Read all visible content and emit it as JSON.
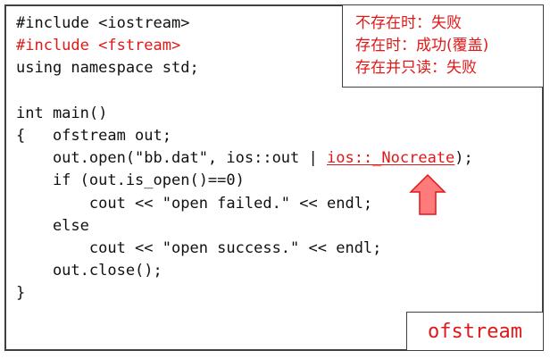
{
  "code": {
    "lines": [
      [
        {
          "text": "#include <iostream>",
          "color": "#111111"
        }
      ],
      [
        {
          "text": "#include <fstream>",
          "color": "#e01818"
        }
      ],
      [
        {
          "text": "using namespace std;",
          "color": "#111111"
        }
      ],
      [
        {
          "text": "",
          "color": "#111111"
        }
      ],
      [
        {
          "text": "int main()",
          "color": "#111111"
        }
      ],
      [
        {
          "text": "{   ofstream out;",
          "color": "#111111"
        }
      ],
      [
        {
          "text": "    out.open(\"bb.dat\", ios::out | ",
          "color": "#111111"
        },
        {
          "text": "ios::_Nocreate",
          "color": "#e01818",
          "underline": true
        },
        {
          "text": ");",
          "color": "#111111"
        }
      ],
      [
        {
          "text": "    if (out.is_open()==0)",
          "color": "#111111"
        }
      ],
      [
        {
          "text": "        cout << \"open failed.\" << endl;",
          "color": "#111111"
        }
      ],
      [
        {
          "text": "    else",
          "color": "#111111"
        }
      ],
      [
        {
          "text": "        cout << \"open success.\" << endl;",
          "color": "#111111"
        }
      ],
      [
        {
          "text": "    out.close();",
          "color": "#111111"
        }
      ],
      [
        {
          "text": "}",
          "color": "#111111"
        }
      ]
    ]
  },
  "notes": {
    "line1": "不存在时：失败",
    "line2": "存在时：成功(覆盖)",
    "line3": "存在并只读：失败"
  },
  "label": {
    "text": "ofstream"
  },
  "arrow": {
    "icon": "up-arrow-icon",
    "fill": "#ff7b7b",
    "stroke": "#e01818"
  }
}
